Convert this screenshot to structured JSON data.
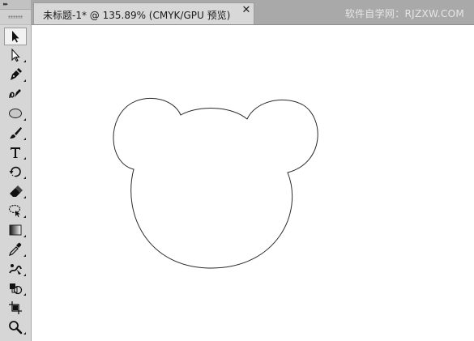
{
  "tab": {
    "title": "未标题-1* @ 135.89% (CMYK/GPU 预览)",
    "close_symbol": "✕"
  },
  "watermark": "软件自学网：RJZXW.COM",
  "toolbar": {
    "grip_symbol": "▸▸",
    "tools": [
      {
        "name": "selection-tool",
        "icon": "arrow-icon",
        "active": true
      },
      {
        "name": "direct-selection-tool",
        "icon": "hollow-arrow-icon"
      },
      {
        "name": "pen-tool",
        "icon": "pen-icon"
      },
      {
        "name": "curvature-tool",
        "icon": "curvature-pen-icon"
      },
      {
        "name": "ellipse-tool",
        "icon": "ellipse-icon"
      },
      {
        "name": "paintbrush-tool",
        "icon": "brush-icon"
      },
      {
        "name": "type-tool",
        "icon": "type-icon"
      },
      {
        "name": "rotate-tool",
        "icon": "rotate-icon"
      },
      {
        "name": "eraser-tool",
        "icon": "eraser-icon"
      },
      {
        "name": "lasso-tool",
        "icon": "lasso-icon"
      },
      {
        "name": "gradient-tool",
        "icon": "gradient-icon"
      },
      {
        "name": "eyedropper-tool",
        "icon": "eyedropper-icon"
      },
      {
        "name": "puppet-warp-tool",
        "icon": "puppet-icon"
      },
      {
        "name": "shape-builder-tool",
        "icon": "shape-builder-icon"
      },
      {
        "name": "artboard-tool",
        "icon": "artboard-icon"
      },
      {
        "name": "zoom-tool",
        "icon": "zoom-icon"
      }
    ]
  },
  "document": {
    "zoom": "135.89%",
    "color_mode": "CMYK/GPU 预览",
    "artwork": "bear-head-outline",
    "stroke_color": "#2b2b2b",
    "fill_color": "#ffffff"
  },
  "colors": {
    "toolbar_bg": "#d6d6d6",
    "tabbar_bg": "#a9a9a9",
    "tab_bg": "#d8d8d8",
    "canvas_bg": "#ffffff"
  }
}
